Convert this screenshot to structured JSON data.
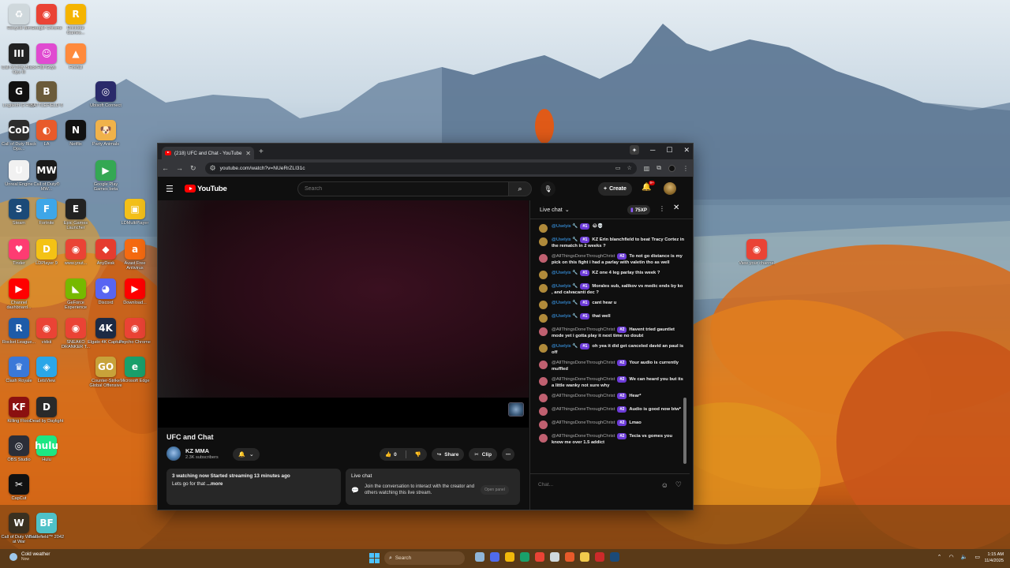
{
  "desktop": {
    "icons": [
      {
        "label": "Recycle Bin",
        "glyph": "♻",
        "color": "#cfd8dc"
      },
      {
        "label": "Google Chrome",
        "glyph": "◉",
        "color": "#ea4335"
      },
      {
        "label": "Rockstar Games...",
        "glyph": "R",
        "color": "#f5b400"
      },
      {
        "label": "Call of Duty Black Ops III",
        "glyph": "III",
        "color": "#222222"
      },
      {
        "label": "Fall Guys",
        "glyph": "☺",
        "color": "#e04bd1"
      },
      {
        "label": "Firefall",
        "glyph": "▲",
        "color": "#ff8a3c"
      },
      {
        "label": "Logitech G HUB",
        "glyph": "G",
        "color": "#111111"
      },
      {
        "label": "BATTLEFIELD 6",
        "glyph": "B",
        "color": "#6b5b3a"
      },
      {
        "label": "Ubisoft Connect",
        "glyph": "◎",
        "color": "#2a2a6a"
      },
      {
        "label": "Call of Duty Black Ops...",
        "glyph": "CoD",
        "color": "#2d2d2d"
      },
      {
        "label": "LA",
        "glyph": "◐",
        "color": "#e85a2a"
      },
      {
        "label": "Netflix",
        "glyph": "N",
        "color": "#111111"
      },
      {
        "label": "Party Animals",
        "glyph": "🐶",
        "color": "#f0b24a"
      },
      {
        "label": "Unreal Engine",
        "glyph": "U",
        "color": "#f1f1f1"
      },
      {
        "label": "Call of Duty® MW...",
        "glyph": "MW",
        "color": "#1a1a1a"
      },
      {
        "label": "Google Play Games beta",
        "glyph": "▶",
        "color": "#34a853"
      },
      {
        "label": "Steam",
        "glyph": "S",
        "color": "#1b4a78"
      },
      {
        "label": "Fortnite",
        "glyph": "F",
        "color": "#3ea6e8"
      },
      {
        "label": "Epic Games Launcher",
        "glyph": "E",
        "color": "#222222"
      },
      {
        "label": "LDMultiPlayer",
        "glyph": "▣",
        "color": "#f3c019"
      },
      {
        "label": "Tinder",
        "glyph": "♥",
        "color": "#fe3c72"
      },
      {
        "label": "LDPlayer 9",
        "glyph": "D",
        "color": "#f4c214"
      },
      {
        "label": "www.yout...",
        "glyph": "◉",
        "color": "#ea4335"
      },
      {
        "label": "AnyDesk",
        "glyph": "◆",
        "color": "#e53c2f"
      },
      {
        "label": "Avast Free Antivirus",
        "glyph": "a",
        "color": "#f56a10"
      },
      {
        "label": "Channel dashboard...",
        "glyph": "▶",
        "color": "#ff0000"
      },
      {
        "label": "GeForce Experience",
        "glyph": "◣",
        "color": "#76b900"
      },
      {
        "label": "Discord",
        "glyph": "◕",
        "color": "#5865f2"
      },
      {
        "label": "Download...",
        "glyph": "▶",
        "color": "#ff0000"
      },
      {
        "label": "Rocket League...",
        "glyph": "R",
        "color": "#1e5ba8"
      },
      {
        "label": "vidsii",
        "glyph": "◉",
        "color": "#ea4335"
      },
      {
        "label": "SNEAKO DRANKER T...",
        "glyph": "◉",
        "color": "#ea4335"
      },
      {
        "label": "Elgato 4K Capture",
        "glyph": "4K",
        "color": "#1c2a44"
      },
      {
        "label": "Psycho Chrome",
        "glyph": "◉",
        "color": "#ea4335"
      },
      {
        "label": "Clash Royale",
        "glyph": "♛",
        "color": "#3a78d8"
      },
      {
        "label": "LetsView",
        "glyph": "◈",
        "color": "#2aa6e8"
      },
      {
        "label": "Counter-Strike Global Offensive",
        "glyph": "GO",
        "color": "#c8a23a"
      },
      {
        "label": "Microsoft Edge",
        "glyph": "e",
        "color": "#1aa06b"
      },
      {
        "label": "Killing Floor",
        "glyph": "KF",
        "color": "#8b1010"
      },
      {
        "label": "Dead by Daylight",
        "glyph": "D",
        "color": "#2a2a2a"
      },
      {
        "label": "OBS Studio",
        "glyph": "◎",
        "color": "#2b2e38"
      },
      {
        "label": "Hulu",
        "glyph": "hulu",
        "color": "#1ce783"
      },
      {
        "label": "CapCut",
        "glyph": "✂",
        "color": "#111111"
      },
      {
        "label": "Call of Duty World at War",
        "glyph": "W",
        "color": "#3a3020"
      },
      {
        "label": "Battlefield™ 2042",
        "glyph": "BF",
        "color": "#4fc2c8"
      },
      {
        "label": "View your channel",
        "glyph": "◉",
        "color": "#ea4335"
      }
    ]
  },
  "browser": {
    "tab_title": "(218) UFC and Chat - YouTube",
    "url": "youtube.com/watch?v=NUeRrZLI31c"
  },
  "youtube": {
    "logo_text": "YouTube",
    "search_placeholder": "Search",
    "create_label": "Create",
    "notification_badge": "9+",
    "video_title": "UFC and Chat",
    "channel_name": "KZ MMA",
    "subscribers": "2.3K subscribers",
    "like_count": "0",
    "share_label": "Share",
    "clip_label": "Clip",
    "description_meta": "3 watching now  Started streaming 13 minutes ago",
    "description_text": "Lets go for that",
    "description_more": "...more",
    "livechat_box_title": "Live chat",
    "livechat_box_text": "Join the conversation to interact with the creator and others watching this live stream.",
    "livechat_box_button": "Open panel"
  },
  "chat": {
    "title": "Live chat",
    "xp": "75XP",
    "input_placeholder": "Chat...",
    "messages": [
      {
        "author": "@Uselyis",
        "badge": "#1",
        "text": "😂💀",
        "style": "blue",
        "avatar": "#b08a3a"
      },
      {
        "author": "@Uselyis",
        "badge": "#1",
        "text": "KZ Erin blanchfield to beat Tracy Cortez in the rematch in 2 weeks ?",
        "style": "blue",
        "avatar": "#b08a3a"
      },
      {
        "author": "@AllThingsDoneThroughChrist",
        "badge": "#2",
        "text": "To not go distance is my pick on this fight i had a parlay with valetin tho as well",
        "style": "gray",
        "avatar": "#c06070"
      },
      {
        "author": "@Uselyis",
        "badge": "#1",
        "text": "KZ one 4 leg parlay this week ?",
        "style": "blue",
        "avatar": "#b08a3a"
      },
      {
        "author": "@Uselyis",
        "badge": "#1",
        "text": "Morales sub, salikov vs medic ends by ko , and calvacanti dec ?",
        "style": "blue",
        "avatar": "#b08a3a"
      },
      {
        "author": "@Uselyis",
        "badge": "#1",
        "text": "cant hear u",
        "style": "blue",
        "avatar": "#b08a3a"
      },
      {
        "author": "@Uselyis",
        "badge": "#1",
        "text": "that well",
        "style": "blue",
        "avatar": "#b08a3a"
      },
      {
        "author": "@AllThingsDoneThroughChrist",
        "badge": "#2",
        "text": "Havent tried gauntlet mode yet i gotta play it next time no doubt",
        "style": "gray",
        "avatar": "#c06070"
      },
      {
        "author": "@Uselyis",
        "badge": "#1",
        "text": "oh yea it did get canceled david an paul is off",
        "style": "blue",
        "avatar": "#b08a3a"
      },
      {
        "author": "@AllThingsDoneThroughChrist",
        "badge": "#2",
        "text": "Your audio is currently muffled",
        "style": "gray",
        "avatar": "#c06070"
      },
      {
        "author": "@AllThingsDoneThroughChrist",
        "badge": "#2",
        "text": "We can heard you but its a little wanky not sure why",
        "style": "gray",
        "avatar": "#c06070"
      },
      {
        "author": "@AllThingsDoneThroughChrist",
        "badge": "#2",
        "text": "Hear*",
        "style": "gray",
        "avatar": "#c06070"
      },
      {
        "author": "@AllThingsDoneThroughChrist",
        "badge": "#2",
        "text": "Audio is good now btw*",
        "style": "gray",
        "avatar": "#c06070"
      },
      {
        "author": "@AllThingsDoneThroughChrist",
        "badge": "#2",
        "text": "Lmao",
        "style": "gray",
        "avatar": "#c06070"
      },
      {
        "author": "@AllThingsDoneThroughChrist",
        "badge": "#2",
        "text": "Tecia vs gomes you know me over 1.5 addict",
        "style": "gray",
        "avatar": "#c06070"
      }
    ]
  },
  "taskbar": {
    "weather_title": "Cold weather",
    "weather_sub": "Now",
    "search_label": "Search",
    "time": "1:15 AM",
    "date": "11/4/2025",
    "app_colors": [
      "#8fb5d8",
      "#4f6bed",
      "#f2b90a",
      "#1aa06b",
      "#ea4335",
      "#cfd8dc",
      "#e85a2a",
      "#f2c94c",
      "#cc2a2a",
      "#1b4a78"
    ]
  }
}
